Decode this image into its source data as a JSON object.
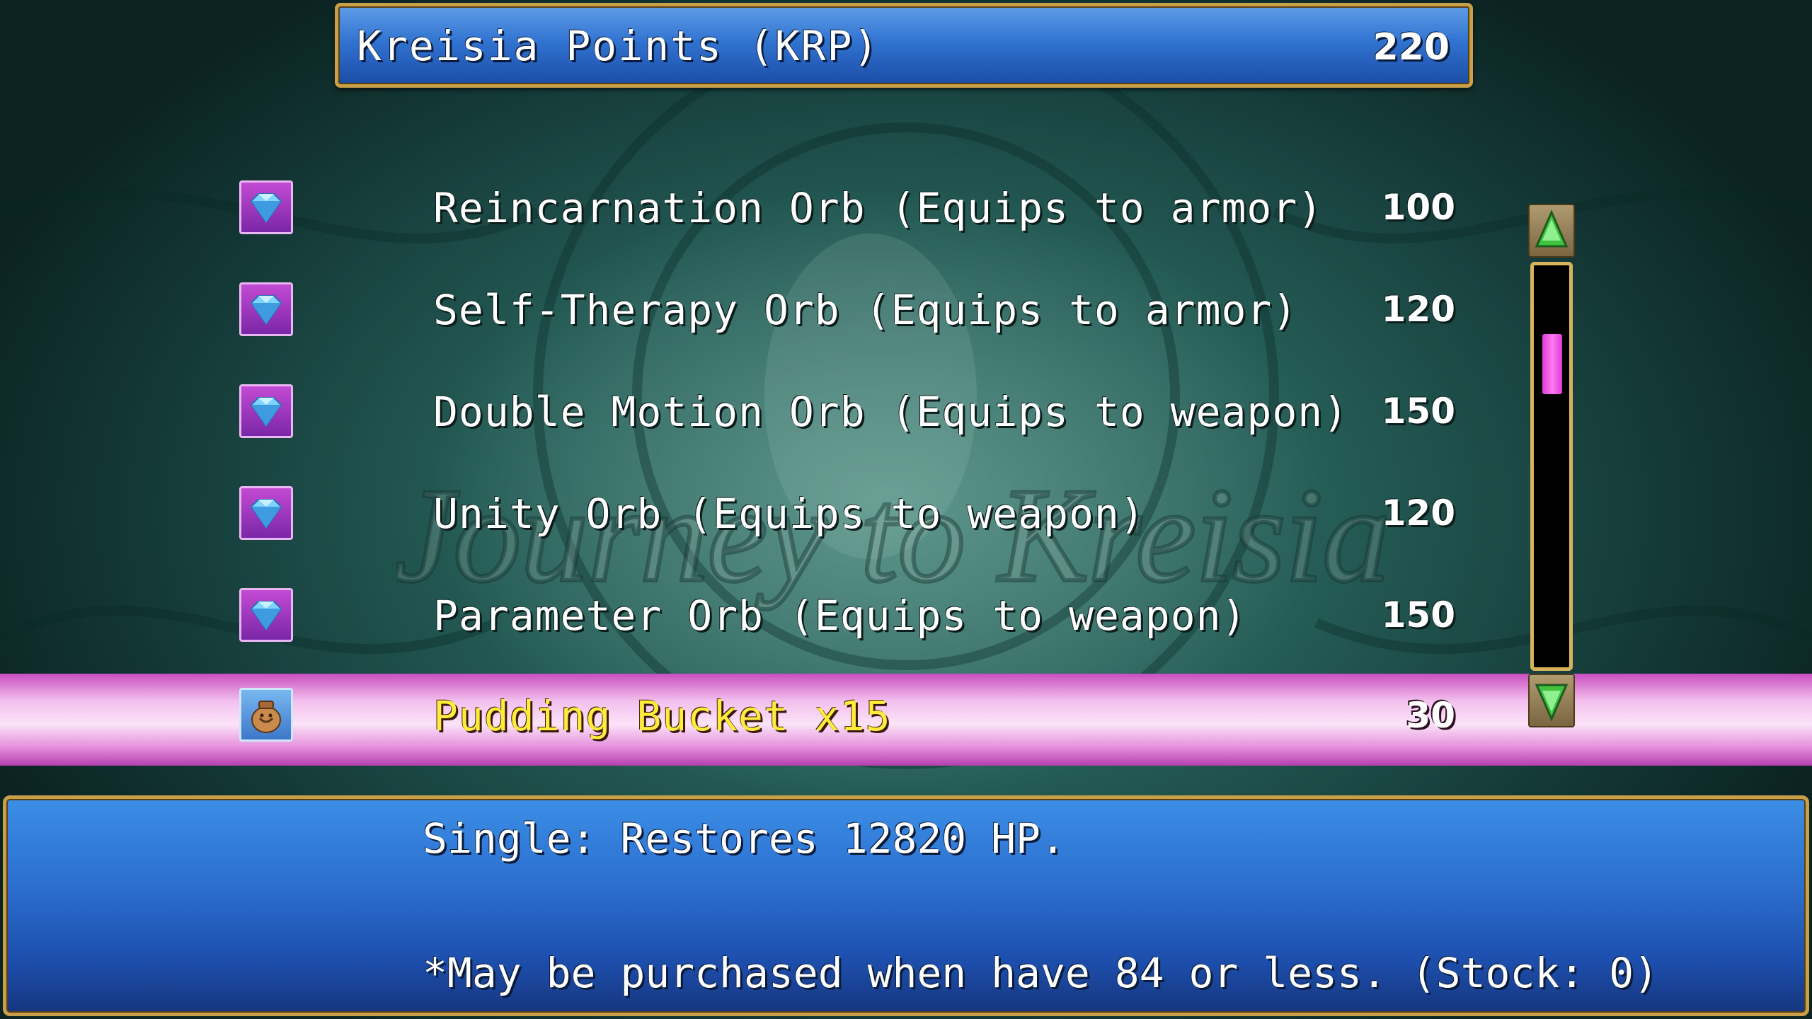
{
  "points": {
    "label": "Kreisia Points (KRP)",
    "value": "220"
  },
  "items": [
    {
      "name": "Reincarnation Orb (Equips to armor)",
      "price": "100",
      "icon": "gem-icon"
    },
    {
      "name": "Self-Therapy Orb (Equips to armor)",
      "price": "120",
      "icon": "gem-icon"
    },
    {
      "name": "Double Motion Orb (Equips to weapon)",
      "price": "150",
      "icon": "gem-icon"
    },
    {
      "name": "Unity Orb (Equips to weapon)",
      "price": "120",
      "icon": "gem-icon"
    },
    {
      "name": "Parameter Orb (Equips to weapon)",
      "price": "150",
      "icon": "gem-icon"
    },
    {
      "name": "Pudding Bucket x15",
      "price": "30",
      "icon": "pudding-bag-icon",
      "selected": true
    }
  ],
  "scrollbar": {
    "thumb_start": 0.17,
    "thumb_end": 0.32
  },
  "help": {
    "line1": "Single: Restores 12820 HP.",
    "line2": "*May be purchased when have 84 or less. (Stock: 0)"
  },
  "background": {
    "logo_text": "Journey to Kreisia"
  },
  "colors": {
    "selected_text": "#ffec3a",
    "frame_gold": "#c9a04a",
    "window_blue": "#2c6fcf",
    "highlight_pink": "#f3c0ee"
  }
}
